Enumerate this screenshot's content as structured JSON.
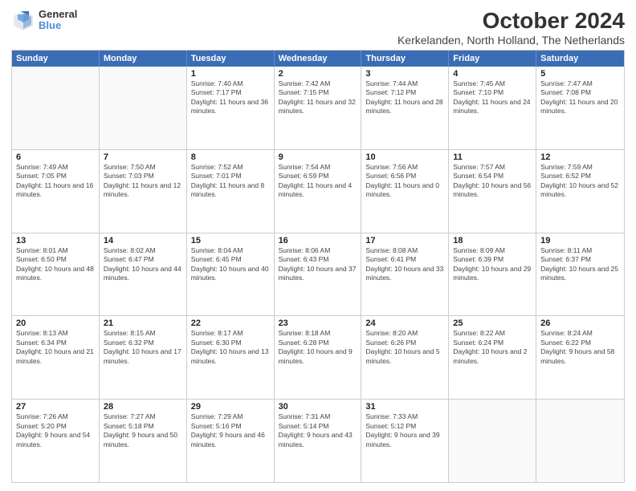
{
  "logo": {
    "general": "General",
    "blue": "Blue"
  },
  "title": "October 2024",
  "location": "Kerkelanden, North Holland, The Netherlands",
  "days": [
    "Sunday",
    "Monday",
    "Tuesday",
    "Wednesday",
    "Thursday",
    "Friday",
    "Saturday"
  ],
  "weeks": [
    [
      {
        "day": "",
        "content": ""
      },
      {
        "day": "",
        "content": ""
      },
      {
        "day": "1",
        "content": "Sunrise: 7:40 AM\nSunset: 7:17 PM\nDaylight: 11 hours and 36 minutes."
      },
      {
        "day": "2",
        "content": "Sunrise: 7:42 AM\nSunset: 7:15 PM\nDaylight: 11 hours and 32 minutes."
      },
      {
        "day": "3",
        "content": "Sunrise: 7:44 AM\nSunset: 7:12 PM\nDaylight: 11 hours and 28 minutes."
      },
      {
        "day": "4",
        "content": "Sunrise: 7:45 AM\nSunset: 7:10 PM\nDaylight: 11 hours and 24 minutes."
      },
      {
        "day": "5",
        "content": "Sunrise: 7:47 AM\nSunset: 7:08 PM\nDaylight: 11 hours and 20 minutes."
      }
    ],
    [
      {
        "day": "6",
        "content": "Sunrise: 7:49 AM\nSunset: 7:05 PM\nDaylight: 11 hours and 16 minutes."
      },
      {
        "day": "7",
        "content": "Sunrise: 7:50 AM\nSunset: 7:03 PM\nDaylight: 11 hours and 12 minutes."
      },
      {
        "day": "8",
        "content": "Sunrise: 7:52 AM\nSunset: 7:01 PM\nDaylight: 11 hours and 8 minutes."
      },
      {
        "day": "9",
        "content": "Sunrise: 7:54 AM\nSunset: 6:59 PM\nDaylight: 11 hours and 4 minutes."
      },
      {
        "day": "10",
        "content": "Sunrise: 7:56 AM\nSunset: 6:56 PM\nDaylight: 11 hours and 0 minutes."
      },
      {
        "day": "11",
        "content": "Sunrise: 7:57 AM\nSunset: 6:54 PM\nDaylight: 10 hours and 56 minutes."
      },
      {
        "day": "12",
        "content": "Sunrise: 7:59 AM\nSunset: 6:52 PM\nDaylight: 10 hours and 52 minutes."
      }
    ],
    [
      {
        "day": "13",
        "content": "Sunrise: 8:01 AM\nSunset: 6:50 PM\nDaylight: 10 hours and 48 minutes."
      },
      {
        "day": "14",
        "content": "Sunrise: 8:02 AM\nSunset: 6:47 PM\nDaylight: 10 hours and 44 minutes."
      },
      {
        "day": "15",
        "content": "Sunrise: 8:04 AM\nSunset: 6:45 PM\nDaylight: 10 hours and 40 minutes."
      },
      {
        "day": "16",
        "content": "Sunrise: 8:06 AM\nSunset: 6:43 PM\nDaylight: 10 hours and 37 minutes."
      },
      {
        "day": "17",
        "content": "Sunrise: 8:08 AM\nSunset: 6:41 PM\nDaylight: 10 hours and 33 minutes."
      },
      {
        "day": "18",
        "content": "Sunrise: 8:09 AM\nSunset: 6:39 PM\nDaylight: 10 hours and 29 minutes."
      },
      {
        "day": "19",
        "content": "Sunrise: 8:11 AM\nSunset: 6:37 PM\nDaylight: 10 hours and 25 minutes."
      }
    ],
    [
      {
        "day": "20",
        "content": "Sunrise: 8:13 AM\nSunset: 6:34 PM\nDaylight: 10 hours and 21 minutes."
      },
      {
        "day": "21",
        "content": "Sunrise: 8:15 AM\nSunset: 6:32 PM\nDaylight: 10 hours and 17 minutes."
      },
      {
        "day": "22",
        "content": "Sunrise: 8:17 AM\nSunset: 6:30 PM\nDaylight: 10 hours and 13 minutes."
      },
      {
        "day": "23",
        "content": "Sunrise: 8:18 AM\nSunset: 6:28 PM\nDaylight: 10 hours and 9 minutes."
      },
      {
        "day": "24",
        "content": "Sunrise: 8:20 AM\nSunset: 6:26 PM\nDaylight: 10 hours and 5 minutes."
      },
      {
        "day": "25",
        "content": "Sunrise: 8:22 AM\nSunset: 6:24 PM\nDaylight: 10 hours and 2 minutes."
      },
      {
        "day": "26",
        "content": "Sunrise: 8:24 AM\nSunset: 6:22 PM\nDaylight: 9 hours and 58 minutes."
      }
    ],
    [
      {
        "day": "27",
        "content": "Sunrise: 7:26 AM\nSunset: 5:20 PM\nDaylight: 9 hours and 54 minutes."
      },
      {
        "day": "28",
        "content": "Sunrise: 7:27 AM\nSunset: 5:18 PM\nDaylight: 9 hours and 50 minutes."
      },
      {
        "day": "29",
        "content": "Sunrise: 7:29 AM\nSunset: 5:16 PM\nDaylight: 9 hours and 46 minutes."
      },
      {
        "day": "30",
        "content": "Sunrise: 7:31 AM\nSunset: 5:14 PM\nDaylight: 9 hours and 43 minutes."
      },
      {
        "day": "31",
        "content": "Sunrise: 7:33 AM\nSunset: 5:12 PM\nDaylight: 9 hours and 39 minutes."
      },
      {
        "day": "",
        "content": ""
      },
      {
        "day": "",
        "content": ""
      }
    ]
  ]
}
